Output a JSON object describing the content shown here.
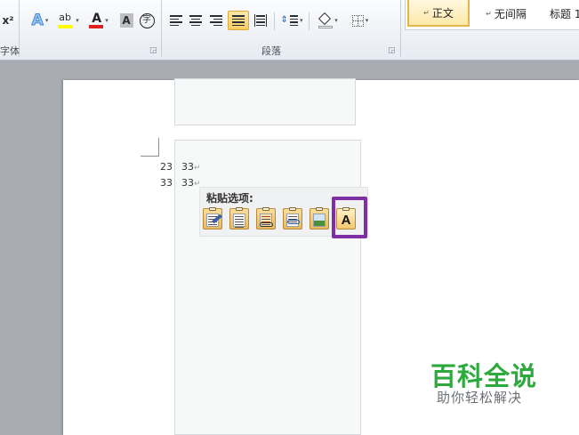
{
  "ribbon": {
    "superscript_label": "x²",
    "font_group_label": "字体",
    "paragraph_group_label": "段落",
    "highlight_label": "ab",
    "font_color_label": "A",
    "char_shading_label": "A",
    "enclose_char_label": "字",
    "styles": [
      {
        "label": "正文",
        "selected": true
      },
      {
        "label": "无间隔",
        "selected": false
      },
      {
        "label": "标题 1",
        "selected": false
      }
    ],
    "colors": {
      "highlight": "#ffff00",
      "font_color": "#e02020",
      "selected_style_border": "#e3b54a"
    }
  },
  "document": {
    "lines": [
      {
        "num": "23",
        "text": "33"
      },
      {
        "num": "33",
        "text": "33"
      }
    ],
    "paragraph_mark": "↵"
  },
  "paste_options": {
    "title": "粘贴选项:",
    "buttons": [
      {
        "name": "keep-source-formatting"
      },
      {
        "name": "merge-formatting"
      },
      {
        "name": "use-destination-styles"
      },
      {
        "name": "link"
      },
      {
        "name": "picture"
      },
      {
        "name": "keep-text-only",
        "glyph": "A"
      }
    ],
    "highlight_color": "#7e2fa6"
  },
  "watermark": {
    "main": "百科全说",
    "sub": "助你轻松解决",
    "color": "#2daa3e"
  }
}
